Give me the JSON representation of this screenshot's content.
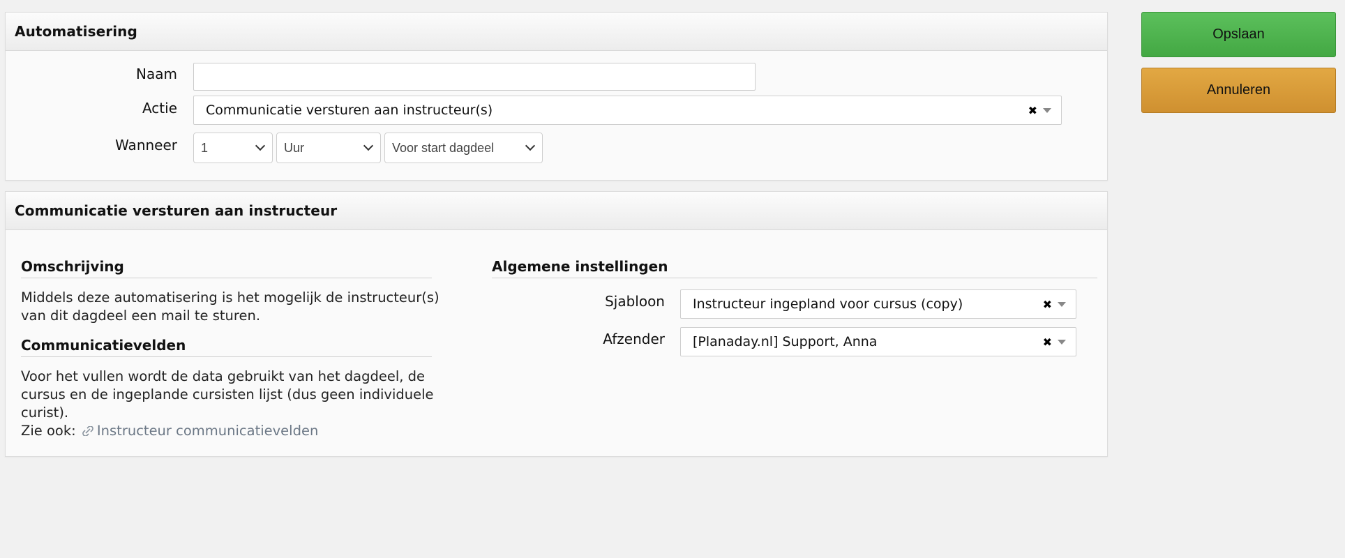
{
  "automation_panel": {
    "title": "Automatisering",
    "name_label": "Naam",
    "name_value": "",
    "action_label": "Actie",
    "action_value": "Communicatie versturen aan instructeur(s)",
    "when_label": "Wanneer",
    "when_amount": "1",
    "when_unit": "Uur",
    "when_relative": "Voor start dagdeel"
  },
  "communication_panel": {
    "title": "Communicatie versturen aan instructeur",
    "description_title": "Omschrijving",
    "description_line1": "Middels deze automatisering is het mogelijk de instructeur(s)",
    "description_line2": "van dit dagdeel een mail te sturen.",
    "fields_title": "Communicatievelden",
    "fields_line1": "Voor het vullen wordt de data gebruikt van het dagdeel, de",
    "fields_line2": "cursus en de ingeplande cursisten lijst (dus geen individuele",
    "fields_line3": "curist).",
    "see_also_label": "Zie ook:",
    "see_also_link": "Instructeur communicatievelden",
    "settings_title": "Algemene instellingen",
    "template_label": "Sjabloon",
    "template_value": "Instructeur ingepland voor cursus (copy)",
    "sender_label": "Afzender",
    "sender_value": "[Planaday.nl] Support, Anna"
  },
  "actions": {
    "save_label": "Opslaan",
    "cancel_label": "Annuleren"
  },
  "colors": {
    "save": "#4cb34c",
    "cancel": "#d99a38",
    "link": "#6b7785"
  },
  "icons": {
    "clear": "clear-icon",
    "caret": "caret-down-icon",
    "link": "link-icon"
  }
}
